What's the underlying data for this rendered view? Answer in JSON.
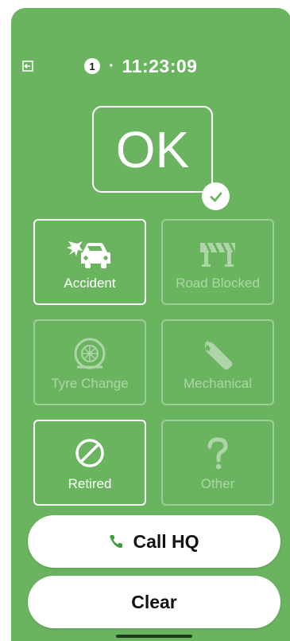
{
  "header": {
    "exit_icon": "exit-icon",
    "count": "1",
    "separator": "·",
    "time": "11:23:09"
  },
  "status": {
    "label": "OK",
    "check_icon": "check-circle-icon"
  },
  "tiles": [
    {
      "label": "Accident",
      "icon": "car-crash-icon",
      "enabled": true
    },
    {
      "label": "Road Blocked",
      "icon": "road-barrier-icon",
      "enabled": false
    },
    {
      "label": "Tyre Change",
      "icon": "tyre-icon",
      "enabled": false
    },
    {
      "label": "Mechanical",
      "icon": "wrench-icon",
      "enabled": false
    },
    {
      "label": "Retired",
      "icon": "no-entry-icon",
      "enabled": true
    },
    {
      "label": "Other",
      "icon": "question-icon",
      "enabled": false
    }
  ],
  "buttons": {
    "call_label": "Call HQ",
    "clear_label": "Clear"
  },
  "colors": {
    "background": "#6ab460",
    "foreground": "#ffffff",
    "phone_icon": "#3f9b3c"
  }
}
